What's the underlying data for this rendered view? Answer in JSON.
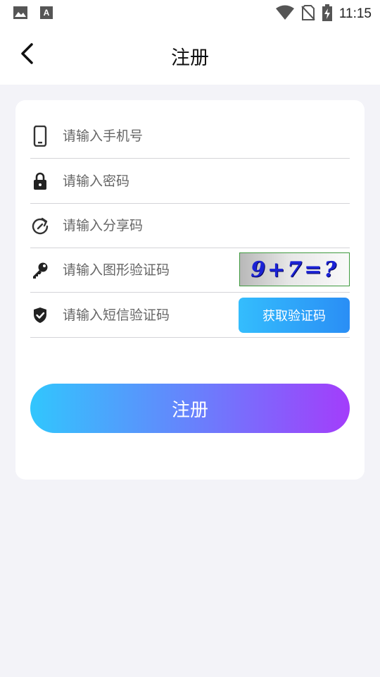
{
  "status_bar": {
    "time": "11:15",
    "left_icons": [
      "image-icon",
      "text-a-icon"
    ],
    "right_icons": [
      "wifi-icon",
      "no-sim-icon",
      "battery-charging-icon"
    ]
  },
  "header": {
    "title": "注册",
    "back_icon": "chevron-left-icon"
  },
  "form": {
    "phone": {
      "placeholder": "请输入手机号",
      "value": "",
      "icon": "phone-icon"
    },
    "password": {
      "placeholder": "请输入密码",
      "value": "",
      "icon": "lock-icon"
    },
    "share_code": {
      "placeholder": "请输入分享码",
      "value": "",
      "icon": "refresh-icon"
    },
    "image_captcha": {
      "placeholder": "请输入图形验证码",
      "value": "",
      "icon": "key-icon",
      "captcha_text": "9+7=?"
    },
    "sms_code": {
      "placeholder": "请输入短信验证码",
      "value": "",
      "icon": "shield-check-icon",
      "button_label": "获取验证码"
    },
    "submit_label": "注册"
  },
  "colors": {
    "background": "#f3f3f8",
    "card": "#ffffff",
    "sms_button_start": "#34bdfd",
    "sms_button_end": "#2a8ef5",
    "submit_gradient": [
      "#31c6fd",
      "#6c7cfc",
      "#a33dfb"
    ]
  }
}
